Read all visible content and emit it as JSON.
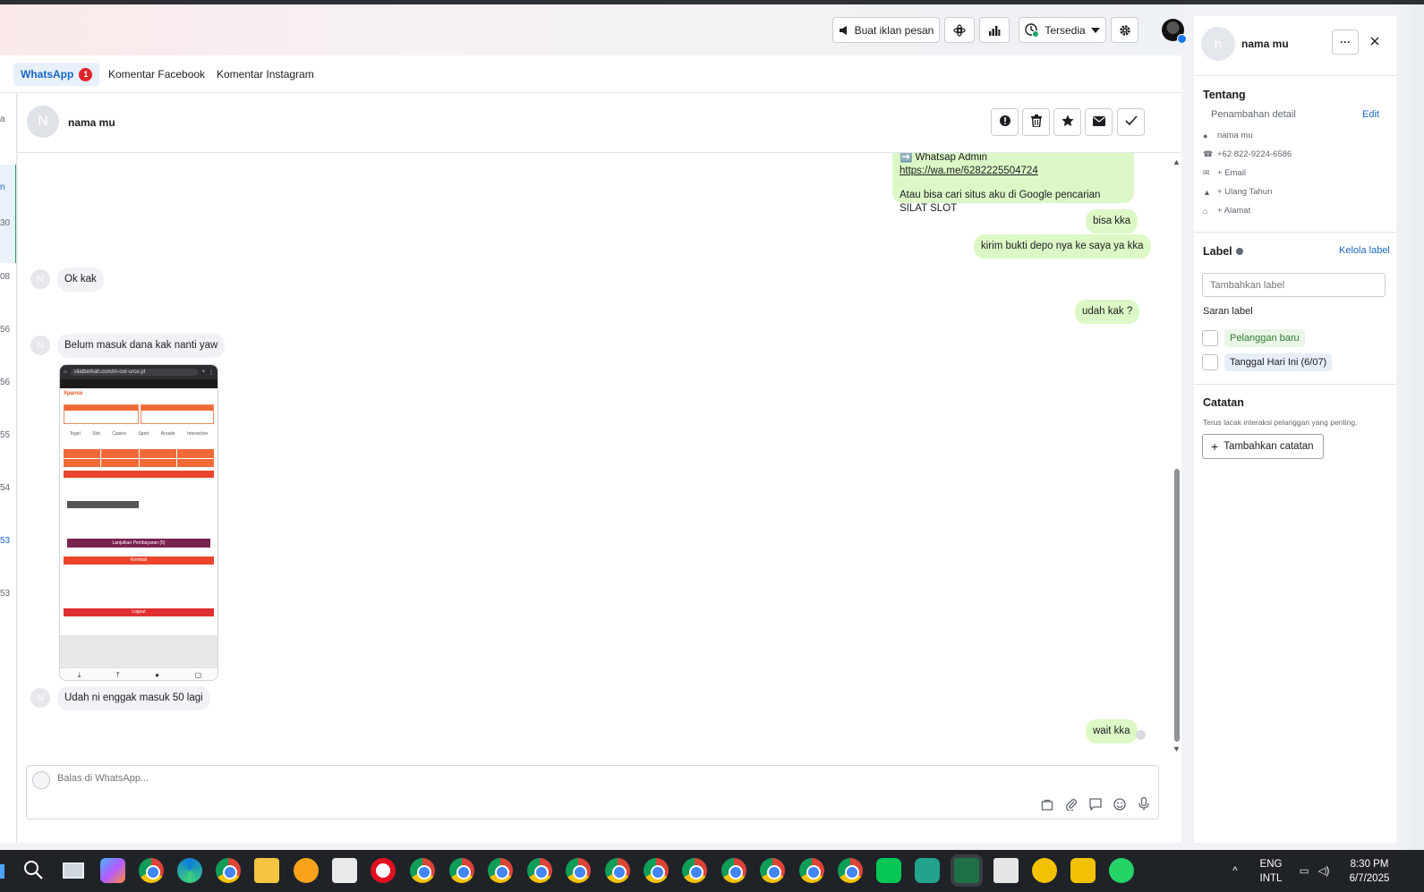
{
  "topbar": {
    "ad_button_label": "Buat iklan pesan",
    "status_label": "Tersedia",
    "icons": [
      "megaphone-icon",
      "apps-icon",
      "insights-icon",
      "status-icon",
      "gear-icon",
      "avatar"
    ]
  },
  "tabs": [
    {
      "label": "WhatsApp",
      "badge": "1"
    },
    {
      "label": "Komentar Facebook"
    },
    {
      "label": "Komentar Instagram"
    }
  ],
  "left_strip": [
    "a",
    "n",
    "30",
    "08",
    "56",
    "56",
    "55",
    "54",
    "53",
    "53"
  ],
  "conversation": {
    "avatar_initial": "N",
    "name": "nama mu",
    "messages": {
      "m1_line1": "➡️ Whatsap Admin",
      "m1_link": "https://wa.me/6282225504724",
      "m1_line2": "Atau bisa cari situs aku di Google pencarian SILAT SLOT",
      "m2": "bisa kka",
      "m3": "kirim bukti depo nya ke saya ya kka",
      "m4": "Ok kak",
      "m5": "udah kak ?",
      "m6": "Belum masuk dana kak nanti yaw",
      "m7": "Udah ni enggak masuk 50 lagi",
      "m8": "wait kka"
    },
    "incoming_avatar": "N",
    "screenshot": {
      "url": "silatberkah.com/m-oor-urce.pl",
      "brand": "Xpanse",
      "nav": [
        "Togel",
        "Slot",
        "Casino",
        "Sport",
        "Arcade",
        "Interactive"
      ],
      "submit": "Lanjutkan Pembayaran (5)",
      "back": "Kembali",
      "logout": "Logout"
    }
  },
  "composer": {
    "placeholder": "Balas di WhatsApp..."
  },
  "panel": {
    "avatar_initial": "n",
    "name": "nama mu",
    "about_title": "Tentang",
    "add_detail": "Penambahan detail",
    "edit": "Edit",
    "details": [
      "nama mu",
      "+62 822-9224-6586",
      "+ Email",
      "+ Ulang Tahun",
      "+ Alamat"
    ],
    "label_title": "Label",
    "manage_label": "Kelola label",
    "label_placeholder": "Tambahkan label",
    "suggest_title": "Saran label",
    "suggestions": [
      "Pelanggan baru",
      "Tanggal Hari Ini (6/07)"
    ],
    "notes_title": "Catatan",
    "notes_desc": "Terus lacak interaksi pelanggan yang penting.",
    "add_note": "Tambahkan catatan"
  },
  "taskbar": {
    "lang1": "ENG",
    "lang2": "INTL",
    "time": "8:30 PM",
    "date": "6/7/2025"
  },
  "colors": {
    "accent": "#1866c4",
    "outgoing_bubble": "#dcf8c6",
    "incoming_bubble": "#f0f2f5",
    "badge": "#e0242c"
  }
}
